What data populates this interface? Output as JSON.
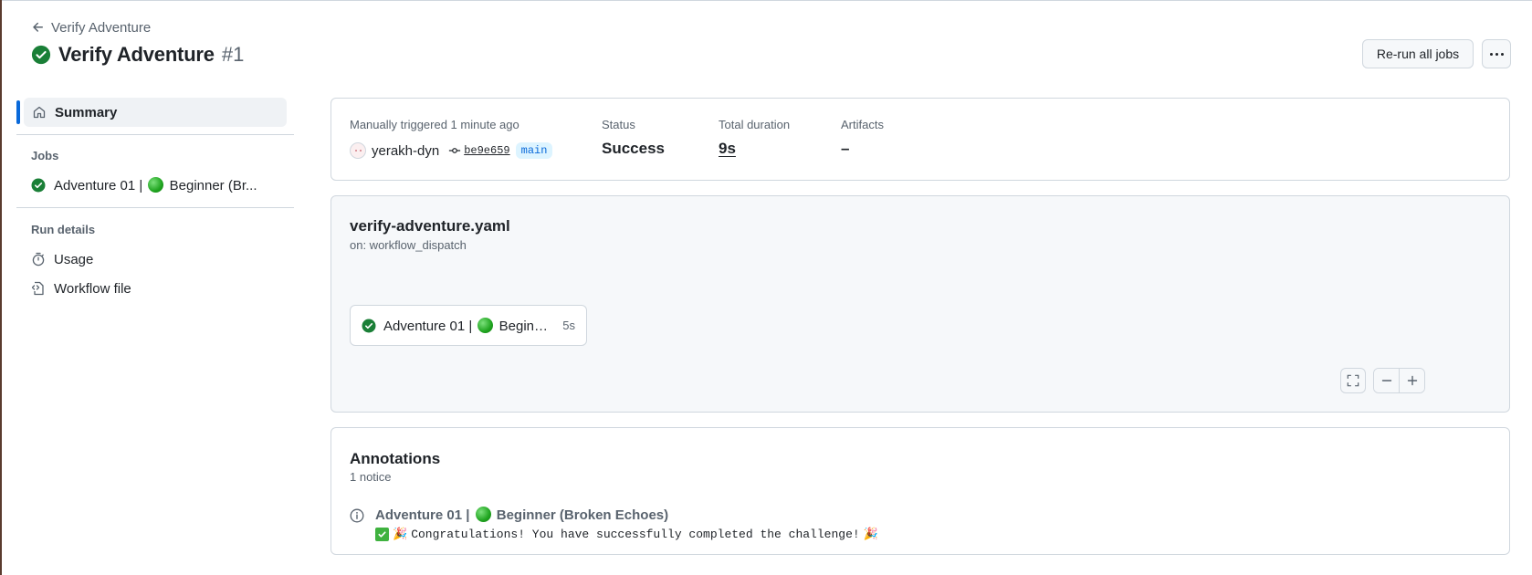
{
  "header": {
    "back_label": "Verify Adventure",
    "title": "Verify Adventure",
    "run_number": "#1",
    "rerun_label": "Re-run all jobs"
  },
  "sidebar": {
    "summary_label": "Summary",
    "jobs_heading": "Jobs",
    "job_label": "Adventure 01 | ",
    "job_label_rest": " Beginner (Br...",
    "run_details_heading": "Run details",
    "usage_label": "Usage",
    "workflow_file_label": "Workflow file"
  },
  "summary": {
    "trigger_text": "Manually triggered 1 minute ago",
    "actor": "yerakh-dyn",
    "commit": "be9e659",
    "branch": "main",
    "status_label": "Status",
    "status_value": "Success",
    "duration_label": "Total duration",
    "duration_value": "9s",
    "artifacts_label": "Artifacts",
    "artifacts_value": "–"
  },
  "workflow": {
    "file_name": "verify-adventure.yaml",
    "trigger": "on: workflow_dispatch",
    "job": {
      "name_prefix": "Adventure 01 | ",
      "name_suffix": " Beginne...",
      "duration": "5s"
    }
  },
  "annotations": {
    "title": "Annotations",
    "count_text": "1 notice",
    "items": [
      {
        "title_prefix": "Adventure 01 | ",
        "title_suffix": " Beginner (Broken Echoes)",
        "message": "Congratulations! You have successfully completed the challenge!",
        "message_emoji_start": "🎉",
        "message_emoji_end": "🎉"
      }
    ]
  },
  "colors": {
    "success": "#1a7f37",
    "accent": "#0969da",
    "border": "#d0d7de",
    "muted_text": "#59636e"
  },
  "icons": [
    "arrow-left-icon",
    "check-circle-icon",
    "kebab-horizontal-icon",
    "home-icon",
    "stopwatch-icon",
    "file-code-icon",
    "git-commit-icon",
    "screen-full-icon",
    "dash-icon",
    "plus-icon",
    "info-icon",
    "green-circle-emoji",
    "check-mark-button-emoji",
    "party-popper-emoji"
  ]
}
